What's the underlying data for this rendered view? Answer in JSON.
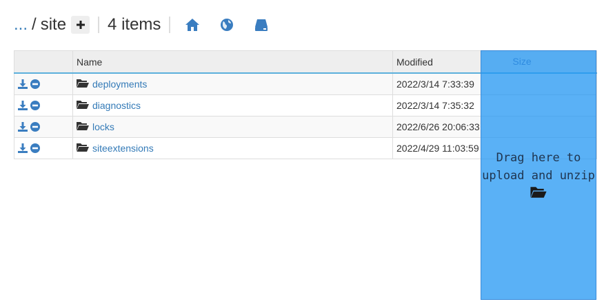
{
  "breadcrumb": {
    "ellipsis": "...",
    "separator": "/",
    "current": "site"
  },
  "item_count": "4 items",
  "nav": {
    "icons": [
      "home-icon",
      "globe-icon",
      "drive-icon"
    ]
  },
  "table": {
    "headers": {
      "name": "Name",
      "modified": "Modified",
      "size": "Size"
    },
    "rows": [
      {
        "name": "deployments",
        "modified": "2022/3/14 7:33:39"
      },
      {
        "name": "diagnostics",
        "modified": "2022/3/14 7:35:32"
      },
      {
        "name": "locks",
        "modified": "2022/6/26 20:06:33"
      },
      {
        "name": "siteextensions",
        "modified": "2022/4/29 11:03:59"
      }
    ]
  },
  "dropzone": {
    "text": "Drag here to\nupload and unzip"
  },
  "colors": {
    "link": "#337ab7",
    "icon": "#3a7dc0",
    "dropzone": "#5aaefb",
    "header_underline": "#5bb0dc"
  }
}
